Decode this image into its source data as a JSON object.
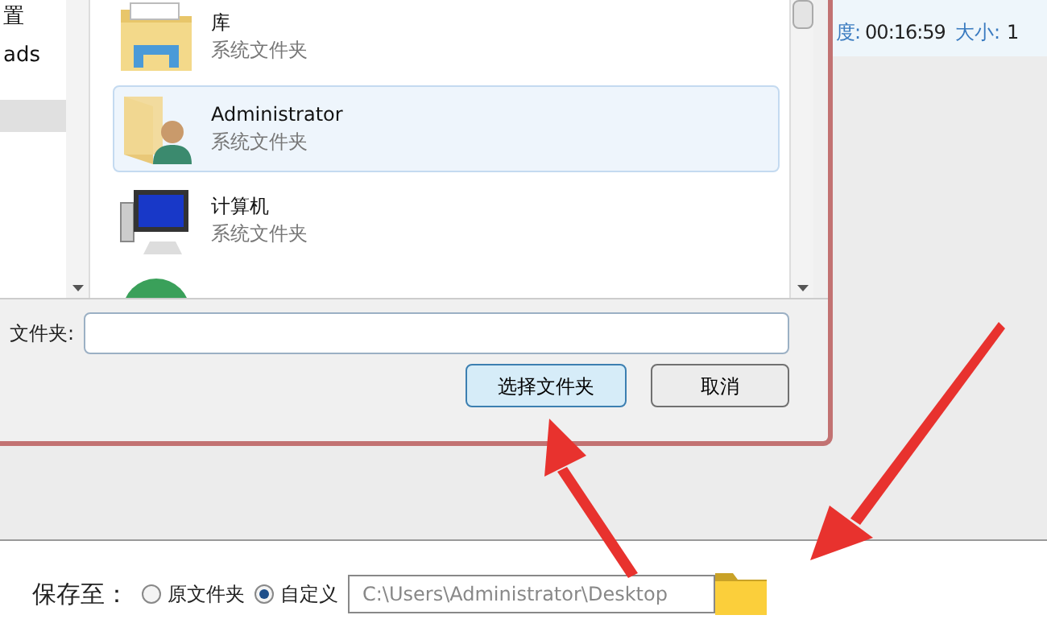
{
  "dialog": {
    "nav_items": [
      {
        "label": "置"
      },
      {
        "label": "ads"
      }
    ],
    "items": [
      {
        "kind": "library",
        "name": "库",
        "type": "系统文件夹",
        "selected": false
      },
      {
        "kind": "user",
        "name": "Administrator",
        "type": "系统文件夹",
        "selected": true
      },
      {
        "kind": "computer",
        "name": "计算机",
        "type": "系统文件夹",
        "selected": false
      },
      {
        "kind": "network",
        "selected": false
      }
    ],
    "folder_label": "文件夹:",
    "buttons": [
      {
        "label": "选择文件夹",
        "default": true
      },
      {
        "label": "取消",
        "default": false
      }
    ]
  },
  "media_info": [
    {
      "label": "度:",
      "value": "00:16:59",
      "label_2": "大小:",
      "value_2": "1"
    }
  ],
  "save_to": {
    "label": "保存至：",
    "options": [
      {
        "label": "原文件夹",
        "selected": false
      },
      {
        "label": "自定义",
        "selected": true
      }
    ],
    "path": "C:\\Users\\Administrator\\Desktop"
  }
}
